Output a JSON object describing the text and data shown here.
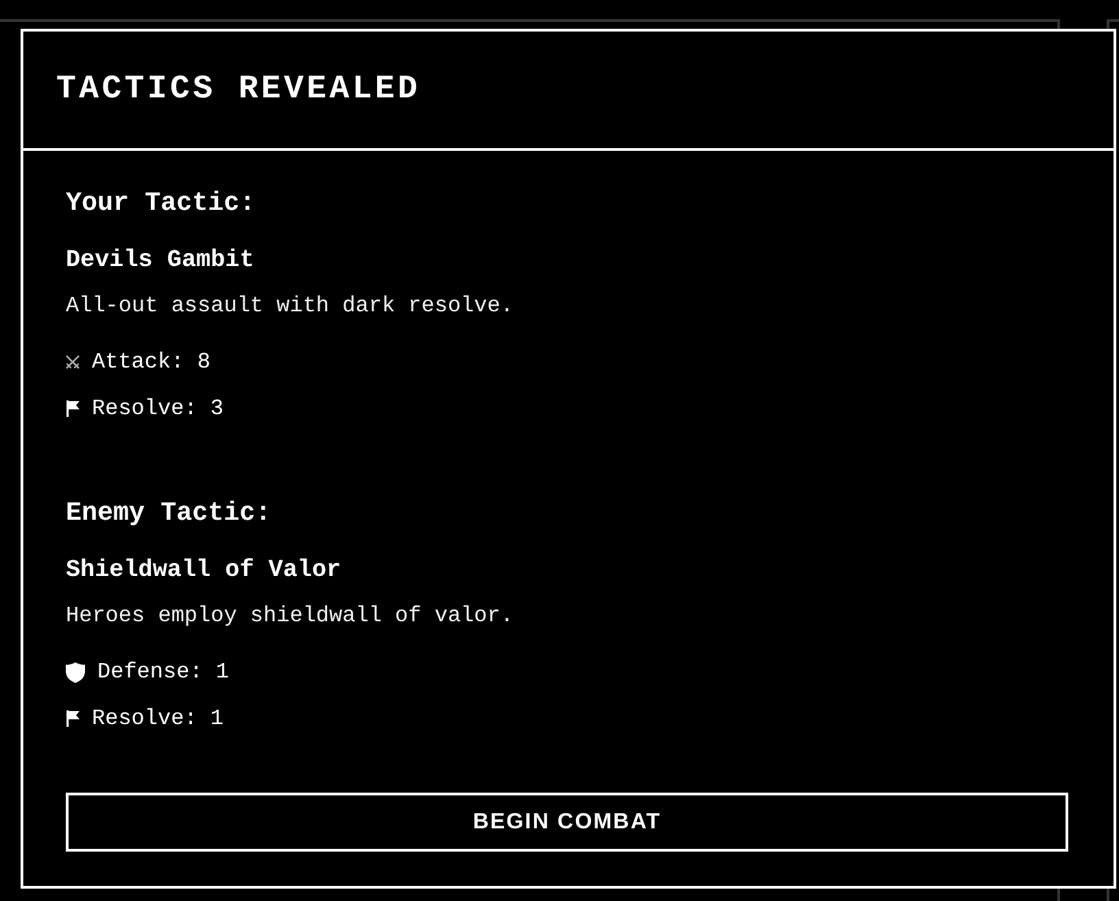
{
  "dialog": {
    "title": "TACTICS REVEALED"
  },
  "sections": [
    {
      "heading": "Your Tactic:",
      "name": "Devils Gambit",
      "description": "All-out assault with dark resolve.",
      "stats": [
        {
          "kind": "attack",
          "text": "Attack: 8"
        },
        {
          "kind": "resolve",
          "text": "Resolve: 3"
        }
      ]
    },
    {
      "heading": "Enemy Tactic:",
      "name": "Shieldwall of Valor",
      "description": "Heroes employ shieldwall of valor.",
      "stats": [
        {
          "kind": "defense",
          "text": "Defense: 1"
        },
        {
          "kind": "resolve",
          "text": "Resolve: 1"
        }
      ]
    }
  ],
  "button": {
    "label": "BEGIN COMBAT"
  }
}
